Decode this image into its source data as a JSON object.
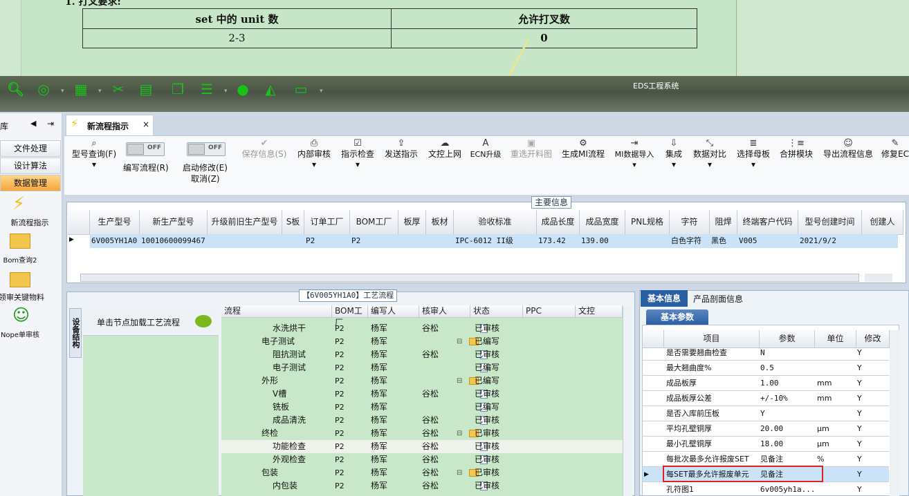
{
  "doc": {
    "heading": "1.   打叉要求:",
    "col1": "set 中的 unit 数",
    "col2": "允许打叉数",
    "val1": "2-3",
    "val2": "0"
  },
  "app": {
    "title": "EDS工程系统"
  },
  "nav": {
    "header": "库",
    "items": [
      "文件处理",
      "设计算法",
      "数据管理"
    ],
    "icons": [
      "新流程指示",
      "Bom查询2",
      "领审关键物料",
      "Nope单审核"
    ]
  },
  "tab": {
    "label": "新流程指示",
    "close": "×"
  },
  "ribbon": {
    "toggles": [
      {
        "label": "编写流程(R)",
        "state": "OFF"
      },
      {
        "label": "启动修改(E)",
        "sub": "取消(Z)",
        "state": "OFF"
      }
    ],
    "buttons": [
      "型号查询(F)",
      "保存信息(S)",
      "内部审核",
      "指示检查",
      "发送指示",
      "文控上网",
      "ECN升级",
      "重选开料图",
      "生成MI流程",
      "MI数据导入",
      "集成",
      "数据对比",
      "选择母板",
      "合拼模块",
      "导出流程信息",
      "修复EC"
    ]
  },
  "main": {
    "legend": "主要信息",
    "headers": [
      "生产型号",
      "新生产型号",
      "升级前旧生产型号",
      "S板",
      "订单工厂",
      "BOM工厂",
      "板厚",
      "板材",
      "验收标准",
      "成品长度",
      "成品宽度",
      "PNL规格",
      "字符",
      "阻焊",
      "终端客户代码",
      "型号创建时间",
      "创建人"
    ],
    "row": [
      "6V005YH1A0",
      "10010600099467",
      "",
      "",
      "P2",
      "P2",
      "",
      "",
      "IPC-6012 II级",
      "173.42",
      "139.00",
      "",
      "白色字符",
      "黑色",
      "V005",
      "2021/9/2",
      ""
    ]
  },
  "flow": {
    "legend": "【6V005YH1A0】工艺流程",
    "side_tab": "设备结构",
    "node_text": "单击节点加载工艺流程",
    "headers": [
      "流程",
      "BOM工厂",
      "编写人",
      "核审人",
      "状态",
      "PPC",
      "文控"
    ],
    "rows": [
      {
        "name": "水洗烘干",
        "bom": "P2",
        "writer": "杨军",
        "checker": "谷松",
        "status": "已审核",
        "level": 2
      },
      {
        "name": "电子测试",
        "bom": "P2",
        "writer": "杨军",
        "checker": "",
        "status": "已编写",
        "level": 1
      },
      {
        "name": "阻抗测试",
        "bom": "P2",
        "writer": "杨军",
        "checker": "谷松",
        "status": "已审核",
        "level": 2
      },
      {
        "name": "电子测试",
        "bom": "P2",
        "writer": "杨军",
        "checker": "",
        "status": "已编写",
        "level": 2
      },
      {
        "name": "外形",
        "bom": "P2",
        "writer": "杨军",
        "checker": "",
        "status": "已编写",
        "level": 1
      },
      {
        "name": "V槽",
        "bom": "P2",
        "writer": "杨军",
        "checker": "谷松",
        "status": "已审核",
        "level": 2
      },
      {
        "name": "铣板",
        "bom": "P2",
        "writer": "杨军",
        "checker": "",
        "status": "已编写",
        "level": 2
      },
      {
        "name": "成品清洗",
        "bom": "P2",
        "writer": "杨军",
        "checker": "谷松",
        "status": "已审核",
        "level": 2
      },
      {
        "name": "终检",
        "bom": "P2",
        "writer": "杨军",
        "checker": "谷松",
        "status": "已审核",
        "level": 1
      },
      {
        "name": "功能检查",
        "bom": "P2",
        "writer": "杨军",
        "checker": "谷松",
        "status": "已审核",
        "level": 2
      },
      {
        "name": "外观检查",
        "bom": "P2",
        "writer": "杨军",
        "checker": "谷松",
        "status": "已审核",
        "level": 2
      },
      {
        "name": "包装",
        "bom": "P2",
        "writer": "杨军",
        "checker": "谷松",
        "status": "已审核",
        "level": 1
      },
      {
        "name": "内包装",
        "bom": "P2",
        "writer": "杨军",
        "checker": "谷松",
        "status": "已审核",
        "level": 2
      }
    ]
  },
  "params": {
    "tabs": [
      "基本信息",
      "产品剖面信息"
    ],
    "subtab": "基本参数",
    "headers": [
      "项目",
      "参数",
      "单位",
      "修改"
    ],
    "rows": [
      {
        "item": "是否需要翘曲检查",
        "value": "N",
        "unit": "",
        "mod": "Y"
      },
      {
        "item": "最大翘曲度%",
        "value": "0.5",
        "unit": "",
        "mod": "Y"
      },
      {
        "item": "成品板厚",
        "value": "1.00",
        "unit": "mm",
        "mod": "Y"
      },
      {
        "item": "成品板厚公差",
        "value": "+/-10%",
        "unit": "mm",
        "mod": "Y"
      },
      {
        "item": "是否入库前压板",
        "value": "Y",
        "unit": "",
        "mod": "Y"
      },
      {
        "item": "平均孔壁铜厚",
        "value": "20.00",
        "unit": "μm",
        "mod": "Y"
      },
      {
        "item": "最小孔壁铜厚",
        "value": "18.00",
        "unit": "μm",
        "mod": "Y"
      },
      {
        "item": "每批次最多允许报废SET",
        "value": "见备注",
        "unit": "%",
        "mod": "Y"
      },
      {
        "item": "每SET最多允许报废单元",
        "value": "见备注",
        "unit": "",
        "mod": "Y"
      },
      {
        "item": "孔符图1",
        "value": "6v005yh1a...",
        "unit": "",
        "mod": "Y"
      }
    ]
  }
}
